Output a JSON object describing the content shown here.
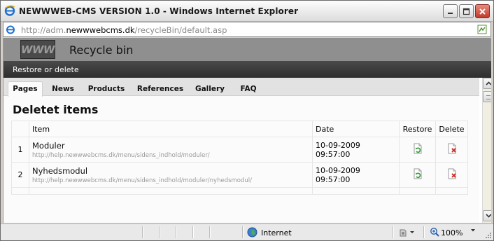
{
  "window": {
    "title": "NEWWWEB-CMS VERSION 1.0 - Windows Internet Explorer"
  },
  "address": {
    "prefix": "http://adm.",
    "host": "newwwebcms.dk",
    "path": "/recycleBin/default.asp"
  },
  "header": {
    "logo_text": "WWW",
    "title": "Recycle bin",
    "subtitle": "Restore or delete"
  },
  "tabs": [
    {
      "label": "Pages",
      "active": true
    },
    {
      "label": "News"
    },
    {
      "label": "Products"
    },
    {
      "label": "References"
    },
    {
      "label": "Gallery"
    },
    {
      "label": "FAQ"
    }
  ],
  "section_title": "Deletet items",
  "table": {
    "headers": {
      "num": "",
      "item": "Item",
      "date": "Date",
      "restore": "Restore",
      "delete": "Delete"
    },
    "rows": [
      {
        "num": "1",
        "name": "Moduler",
        "url": "http://help.newwwebcms.dk/menu/sidens_indhold/moduler/",
        "date": "10-09-2009 09:57:00"
      },
      {
        "num": "2",
        "name": "Nyhedsmodul",
        "url": "http://help.newwwebcms.dk/menu/sidens_indhold/moduler/nyhedsmodul/",
        "date": "10-09-2009 09:57:00"
      }
    ]
  },
  "statusbar": {
    "zone": "Internet",
    "zoom": "100%"
  },
  "icons": {
    "restore": "restore-page-icon",
    "delete": "delete-page-icon"
  }
}
